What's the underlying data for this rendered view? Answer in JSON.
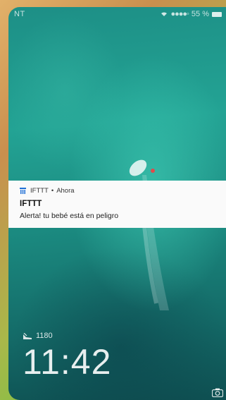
{
  "status_bar": {
    "carrier": "NT",
    "battery": "55 %"
  },
  "notification": {
    "app_name": "IFTTT",
    "separator": "•",
    "time": "Ahora",
    "title": "IFTTT",
    "text": "Alerta! tu bebé está en peligro"
  },
  "lockscreen": {
    "steps": "1180",
    "time": "11:42"
  },
  "icons": {
    "app_icon": "ifttt-icon",
    "steps_icon": "shoe-icon",
    "camera_icon": "camera-icon"
  },
  "colors": {
    "notification_bg": "#fafafa",
    "wallpaper": "#1d8f86"
  }
}
